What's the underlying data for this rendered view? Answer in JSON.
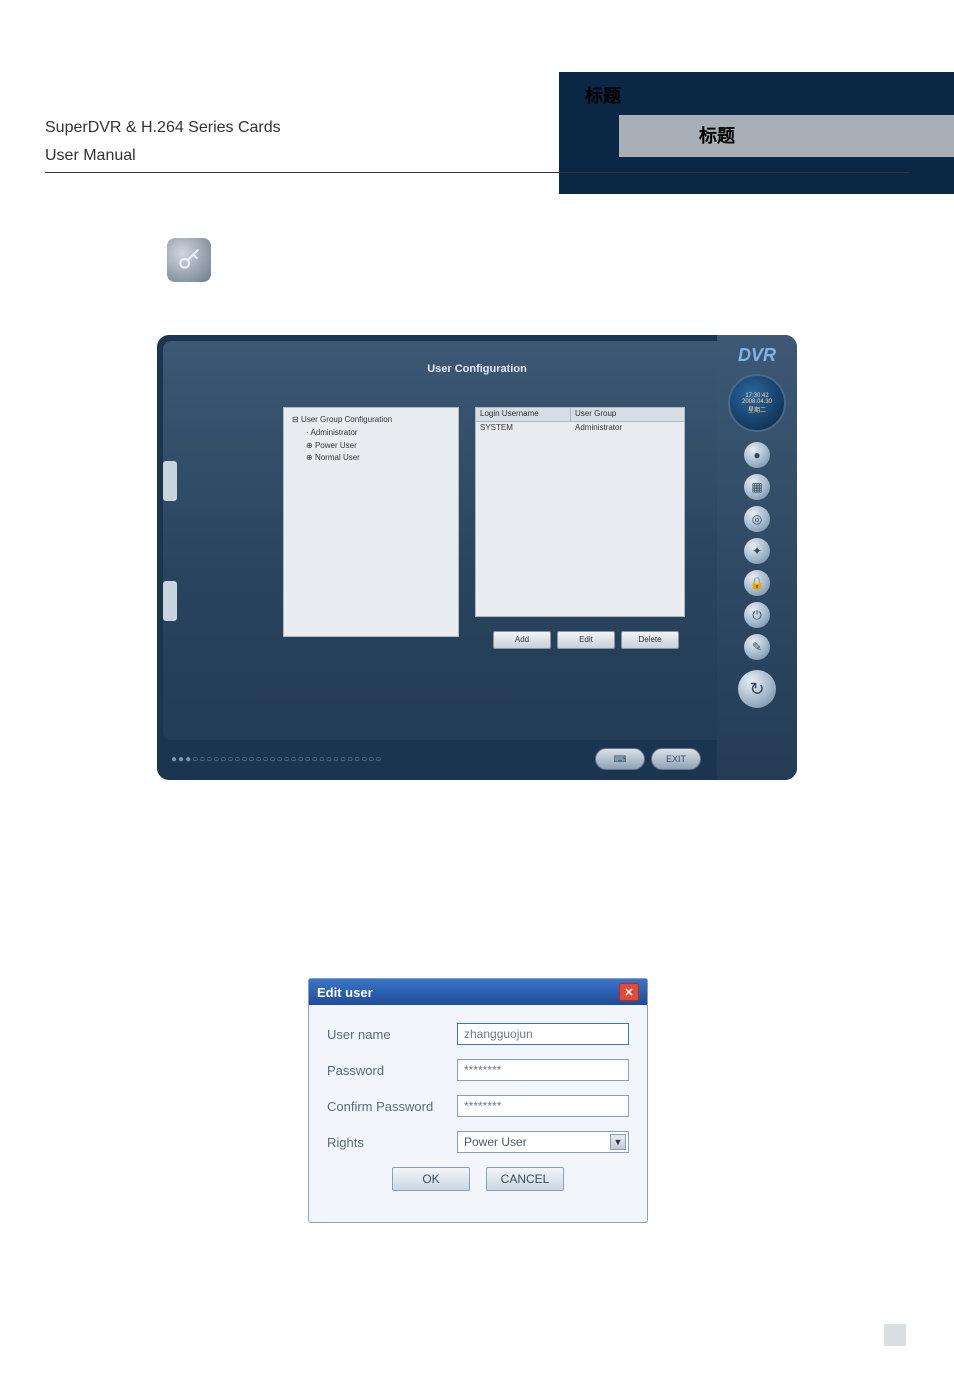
{
  "header": {
    "doc_title": "SuperDVR & H.264 Series Cards",
    "doc_subtitle": "User Manual",
    "placeholder_label_1": "标题",
    "placeholder_label_2": "标题"
  },
  "user_config": {
    "panel_title": "User Configuration",
    "tree": {
      "root": "User Group Configuration",
      "items": [
        "Administrator",
        "Power User",
        "Normal User"
      ]
    },
    "table": {
      "header1": "Login Username",
      "header2": "User Group",
      "row1_login": "SYSTEM",
      "row1_group": "Administrator"
    },
    "buttons": {
      "add": "Add",
      "edit": "Edit",
      "delete": "Delete"
    },
    "right_strip": {
      "logo": "DVR",
      "clock_time": "17:30:42",
      "clock_date": "2008.04.30",
      "clock_day": "星期二"
    },
    "bottom_bar": {
      "btn_ok_icon": "⌨",
      "btn_exit": "EXIT"
    }
  },
  "edit_user": {
    "title": "Edit user",
    "labels": {
      "username": "User name",
      "password": "Password",
      "confirm": "Confirm Password",
      "rights": "Rights"
    },
    "values": {
      "username": "zhangguojun",
      "password_mask": "********",
      "confirm_mask": "********",
      "rights_selected": "Power User"
    },
    "buttons": {
      "ok": "OK",
      "cancel": "CANCEL"
    }
  }
}
